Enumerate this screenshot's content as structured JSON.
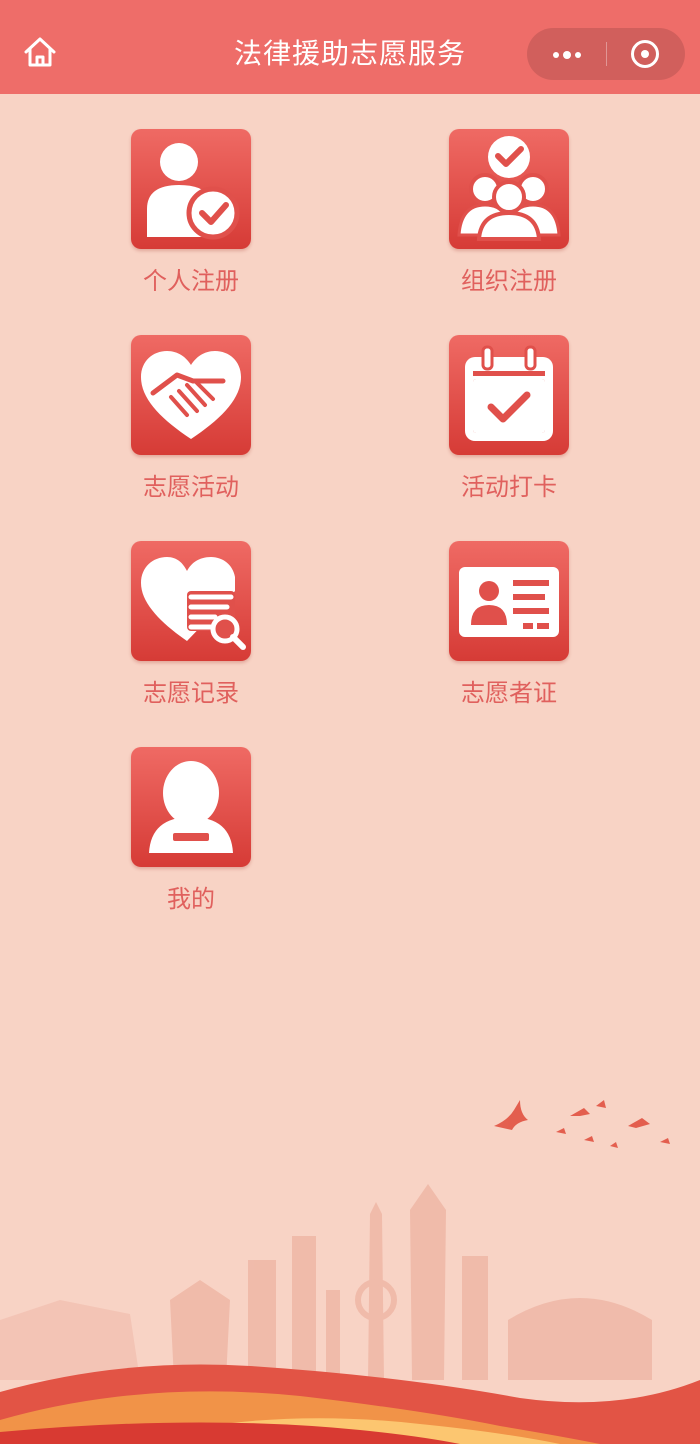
{
  "header": {
    "title": "法律援助志愿服务",
    "home_icon": "home-icon",
    "more_icon": "more-dots-icon",
    "close_icon": "target-circle-icon"
  },
  "menu": {
    "items": [
      {
        "label": "个人注册",
        "icon": "person-check-icon"
      },
      {
        "label": "组织注册",
        "icon": "group-check-icon"
      },
      {
        "label": "志愿活动",
        "icon": "heart-handshake-icon"
      },
      {
        "label": "活动打卡",
        "icon": "calendar-check-icon"
      },
      {
        "label": "志愿记录",
        "icon": "heart-search-icon"
      },
      {
        "label": "志愿者证",
        "icon": "id-card-icon"
      },
      {
        "label": "我的",
        "icon": "user-profile-icon"
      }
    ]
  },
  "theme": {
    "navbar_color": "#ee6d69",
    "background_color": "#f8d3c5",
    "accent_red": "#d63b36",
    "label_color": "#e0605d"
  }
}
